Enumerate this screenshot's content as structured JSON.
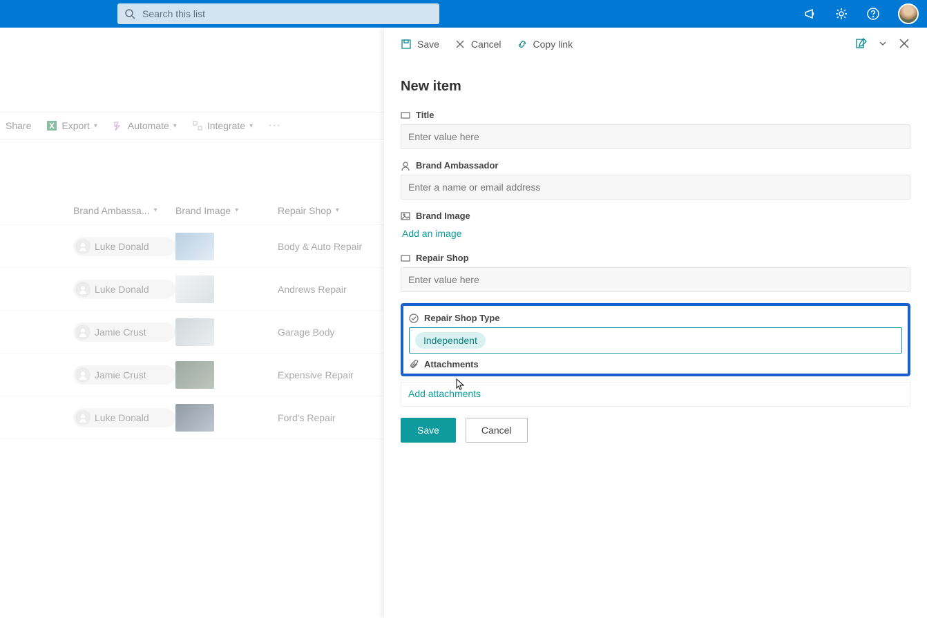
{
  "topbar": {
    "search_placeholder": "Search this list"
  },
  "cmdbar": {
    "share": "Share",
    "export": "Export",
    "automate": "Automate",
    "integrate": "Integrate"
  },
  "headers": {
    "ambassador": "Brand Ambassa...",
    "image": "Brand Image",
    "shop": "Repair Shop"
  },
  "rows": [
    {
      "ambassador": "Luke Donald",
      "shop": "Body & Auto Repair",
      "thumb": "a"
    },
    {
      "ambassador": "Luke Donald",
      "shop": "Andrews Repair",
      "thumb": "b"
    },
    {
      "ambassador": "Jamie Crust",
      "shop": "Garage Body",
      "thumb": "c"
    },
    {
      "ambassador": "Jamie Crust",
      "shop": "Expensive Repair",
      "thumb": "d"
    },
    {
      "ambassador": "Luke Donald",
      "shop": "Ford's Repair",
      "thumb": "e"
    }
  ],
  "panel": {
    "cmd": {
      "save": "Save",
      "cancel": "Cancel",
      "copy": "Copy link"
    },
    "title": "New item",
    "fields": {
      "title_label": "Title",
      "title_placeholder": "Enter value here",
      "ambassador_label": "Brand Ambassador",
      "ambassador_placeholder": "Enter a name or email address",
      "image_label": "Brand Image",
      "image_action": "Add an image",
      "shop_label": "Repair Shop",
      "shop_placeholder": "Enter value here",
      "shoptype_label": "Repair Shop Type",
      "shoptype_value": "Independent",
      "attachments_label": "Attachments",
      "attachments_action": "Add attachments"
    },
    "actions": {
      "save": "Save",
      "cancel": "Cancel"
    }
  }
}
